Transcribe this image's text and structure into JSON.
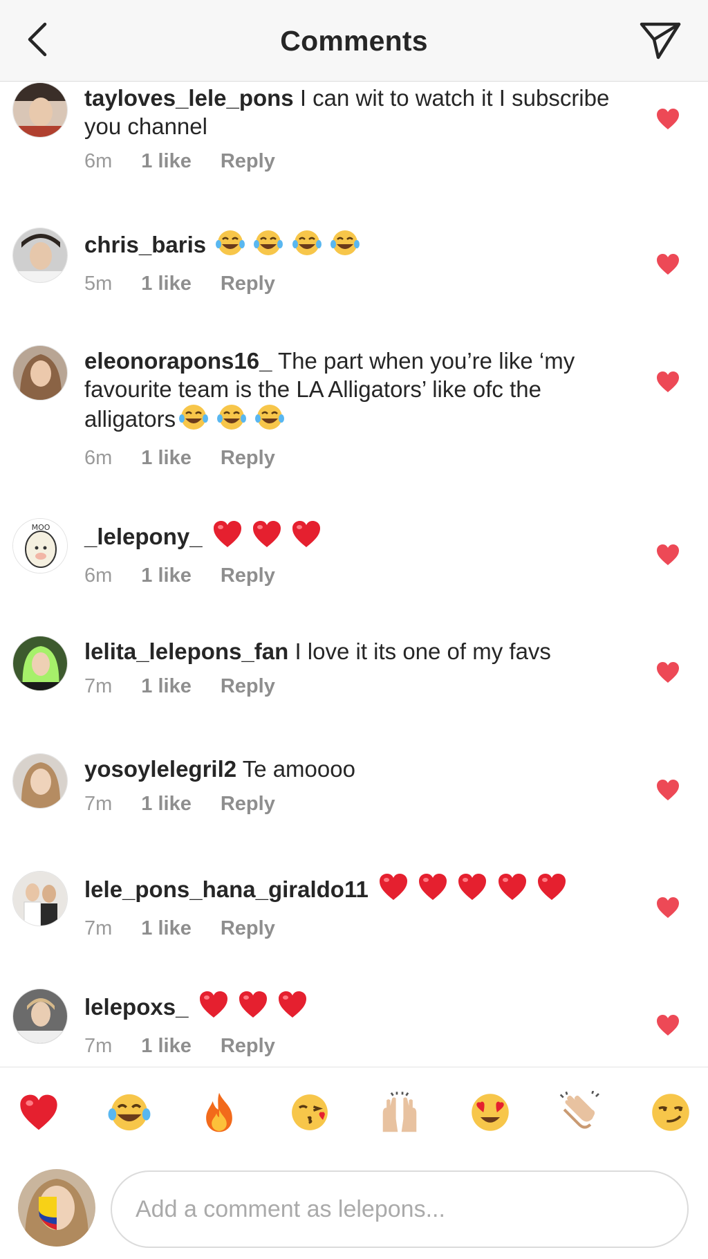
{
  "header": {
    "title": "Comments",
    "back_icon": "chevron-left-icon",
    "send_icon": "paper-plane-icon"
  },
  "colors": {
    "heart": "#ed4956",
    "meta_text": "#999999",
    "text": "#262626"
  },
  "comments": [
    {
      "username": "tayloves_lele_pons",
      "text": "I can wit to watch it I subscribe you channel",
      "emojis": [],
      "time": "6m",
      "likes": "1 like",
      "reply": "Reply",
      "liked": true
    },
    {
      "username": "chris_baris",
      "text": "",
      "emojis": [
        "tears-of-joy-emoji",
        "tears-of-joy-emoji",
        "tears-of-joy-emoji",
        "tears-of-joy-emoji"
      ],
      "time": "5m",
      "likes": "1 like",
      "reply": "Reply",
      "liked": true
    },
    {
      "username": "eleonorapons16_",
      "text": "The part when you’re like ‘my favourite team is the LA Alligators’ like ofc the alligators",
      "emojis": [
        "tears-of-joy-emoji",
        "tears-of-joy-emoji",
        "tears-of-joy-emoji"
      ],
      "time": "6m",
      "likes": "1 like",
      "reply": "Reply",
      "liked": true
    },
    {
      "username": "_lelepony_",
      "text": "",
      "emojis": [
        "red-heart-emoji",
        "red-heart-emoji",
        "red-heart-emoji"
      ],
      "time": "6m",
      "likes": "1 like",
      "reply": "Reply",
      "liked": true
    },
    {
      "username": "lelita_lelepons_fan",
      "text": "I love it its one of my favs",
      "emojis": [],
      "time": "7m",
      "likes": "1 like",
      "reply": "Reply",
      "liked": true
    },
    {
      "username": "yosoylelegril2",
      "text": "Te amoooo",
      "emojis": [],
      "time": "7m",
      "likes": "1 like",
      "reply": "Reply",
      "liked": true
    },
    {
      "username": "lele_pons_hana_giraldo11",
      "text": "",
      "emojis": [
        "red-heart-emoji",
        "red-heart-emoji",
        "red-heart-emoji",
        "red-heart-emoji",
        "red-heart-emoji"
      ],
      "time": "7m",
      "likes": "1 like",
      "reply": "Reply",
      "liked": true
    },
    {
      "username": "lelepoxs_",
      "text": "",
      "emojis": [
        "red-heart-emoji",
        "red-heart-emoji",
        "red-heart-emoji"
      ],
      "time": "7m",
      "likes": "1 like",
      "reply": "Reply",
      "liked": true
    }
  ],
  "emoji_bar": [
    "red-heart-emoji",
    "tears-of-joy-emoji",
    "fire-emoji",
    "face-blowing-kiss-emoji",
    "raising-hands-emoji",
    "heart-eyes-emoji",
    "clapping-hands-emoji",
    "smirking-face-emoji"
  ],
  "composer": {
    "placeholder": "Add a comment as lelepons...",
    "value": ""
  }
}
